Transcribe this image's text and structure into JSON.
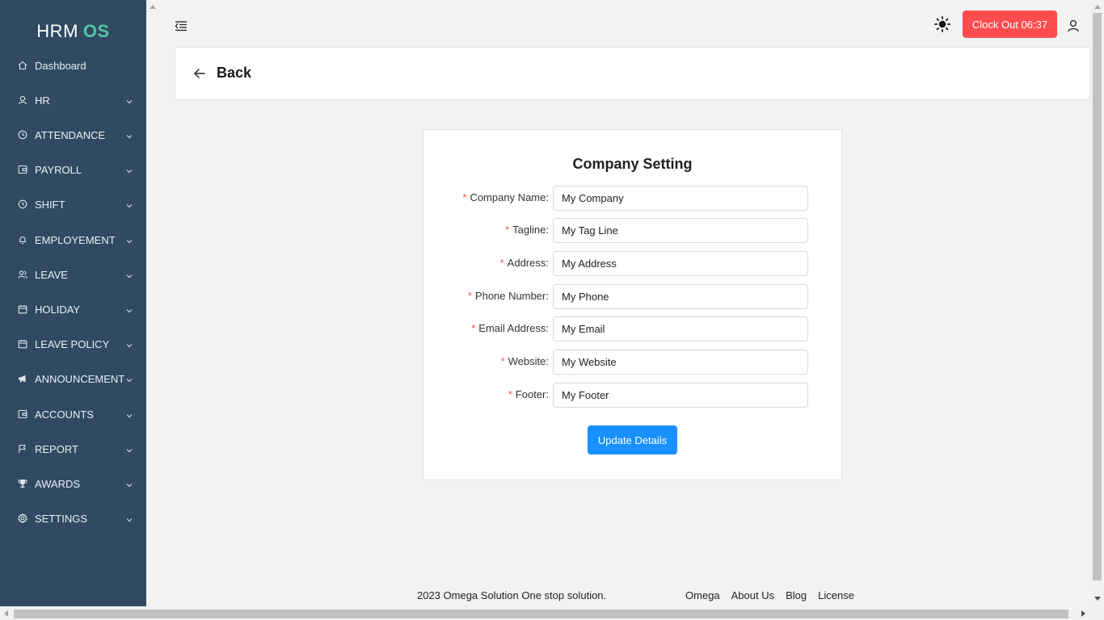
{
  "app": {
    "logo_main": "HRM",
    "logo_accent": "OS"
  },
  "sidebar": {
    "items": [
      {
        "label": "Dashboard",
        "icon": "home-icon",
        "expandable": false
      },
      {
        "label": "HR",
        "icon": "user-icon",
        "expandable": true
      },
      {
        "label": "ATTENDANCE",
        "icon": "clock-icon",
        "expandable": true
      },
      {
        "label": "PAYROLL",
        "icon": "wallet-icon",
        "expandable": true
      },
      {
        "label": "SHIFT",
        "icon": "clock-icon",
        "expandable": true
      },
      {
        "label": "EMPLOYEMENT",
        "icon": "bell-icon",
        "expandable": true
      },
      {
        "label": "LEAVE",
        "icon": "users-icon",
        "expandable": true
      },
      {
        "label": "HOLIDAY",
        "icon": "calendar-icon",
        "expandable": true
      },
      {
        "label": "LEAVE POLICY",
        "icon": "calendar-icon",
        "expandable": true
      },
      {
        "label": "ANNOUNCEMENT",
        "icon": "megaphone-icon",
        "expandable": true
      },
      {
        "label": "ACCOUNTS",
        "icon": "wallet-icon",
        "expandable": true
      },
      {
        "label": "REPORT",
        "icon": "flag-icon",
        "expandable": true
      },
      {
        "label": "AWARDS",
        "icon": "trophy-icon",
        "expandable": true
      },
      {
        "label": "SETTINGS",
        "icon": "gear-icon",
        "expandable": true
      }
    ]
  },
  "topbar": {
    "clock_out_label": "Clock Out 06:37"
  },
  "back": {
    "label": "Back"
  },
  "form": {
    "title": "Company Setting",
    "fields": [
      {
        "label": "Company Name",
        "value": "My Company"
      },
      {
        "label": "Tagline",
        "value": "My Tag Line"
      },
      {
        "label": "Address",
        "value": "My Address"
      },
      {
        "label": "Phone Number",
        "value": "My Phone"
      },
      {
        "label": "Email Address",
        "value": "My Email"
      },
      {
        "label": "Website",
        "value": "My Website"
      },
      {
        "label": "Footer",
        "value": "My Footer"
      }
    ],
    "submit_label": "Update Details"
  },
  "footer": {
    "text": "2023 Omega Solution One stop solution.",
    "links": [
      "Omega",
      "About Us",
      "Blog",
      "License"
    ]
  },
  "colors": {
    "sidebar_bg": "#2f4a62",
    "logo_accent": "#53c6a3",
    "clock_out_bg": "#ff4d4f",
    "primary": "#1890ff",
    "required": "#ff4d4f"
  }
}
